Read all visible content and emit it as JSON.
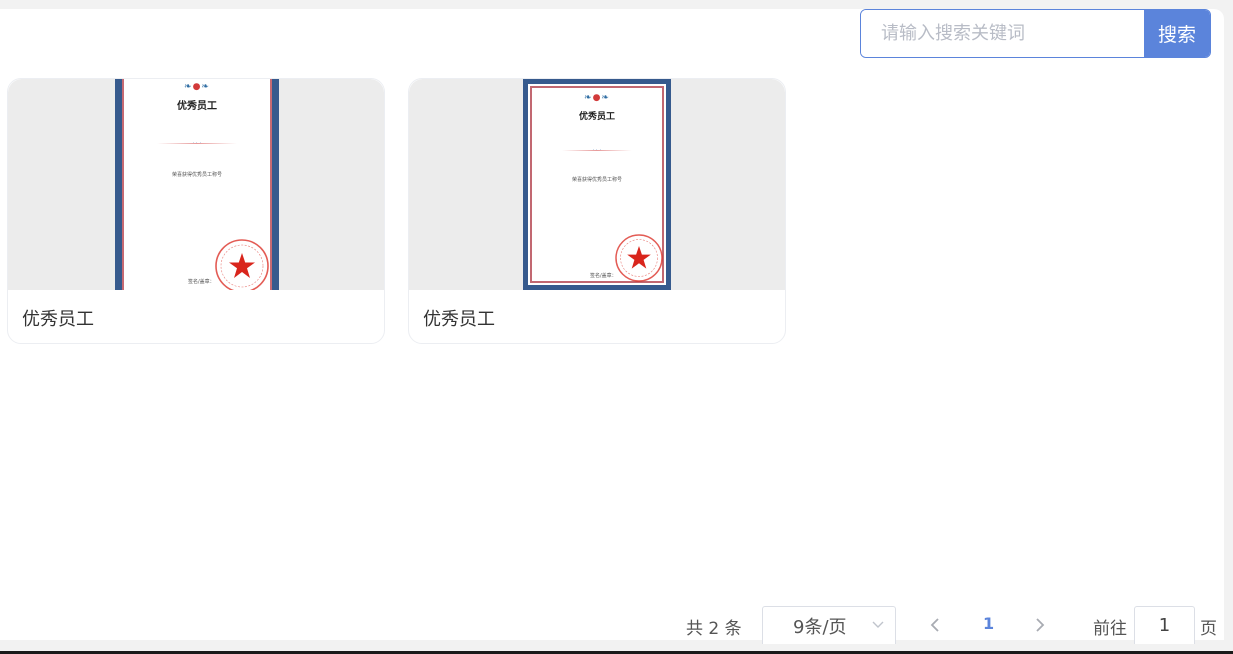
{
  "search": {
    "placeholder": "请输入搜索关键词",
    "button_label": "搜索"
  },
  "cards": [
    {
      "name": "优秀员工",
      "certificate": {
        "title": "优秀员工",
        "body": "荣喜获得优秀员工称号",
        "sign": "签名/盖章："
      }
    },
    {
      "name": "优秀员工",
      "certificate": {
        "title": "优秀员工",
        "body": "荣喜获得优秀员工称号",
        "sign": "签名/盖章："
      }
    }
  ],
  "pagination": {
    "total_text": "共 2 条",
    "page_size": "9条/页",
    "current_page": "1",
    "goto_label": "前往",
    "goto_value": "1",
    "page_unit": "页"
  },
  "colors": {
    "accent": "#5b84db",
    "cert_frame": "#365a8d",
    "cert_red": "#c26871",
    "seal_red": "#d9251c"
  },
  "icons": {
    "prev": "chevron-left-icon",
    "next": "chevron-right-icon",
    "select": "chevron-down-icon"
  }
}
